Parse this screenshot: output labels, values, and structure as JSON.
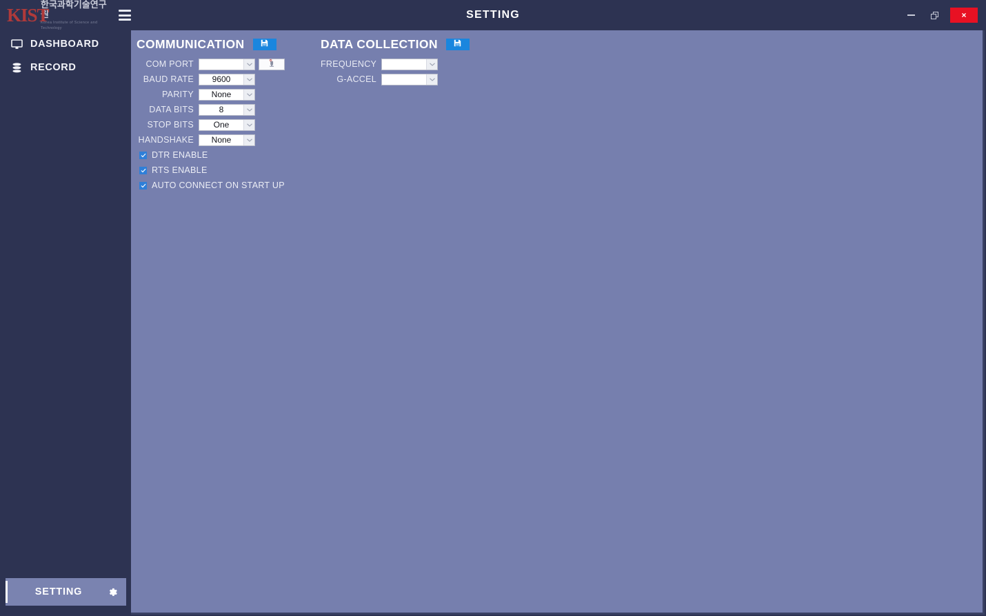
{
  "window": {
    "title": "SETTING",
    "minimize_label": "minimize",
    "restore_label": "restore",
    "close_label": "×"
  },
  "brand": {
    "logo_text": "KIST",
    "name_ko": "한국과학기술연구원",
    "name_en": "Korea Institute of Science and Technology",
    "menu_icon": "hamburger-icon"
  },
  "sidebar": {
    "items": [
      {
        "label": "DASHBOARD",
        "icon": "monitor-icon",
        "active": false
      },
      {
        "label": "RECORD",
        "icon": "database-icon",
        "active": false
      }
    ],
    "footer_item": {
      "label": "SETTING",
      "icon": "gear-icon",
      "active": true
    }
  },
  "panels": [
    {
      "title": "COMMUNICATION",
      "save_icon": "save-floppy-icon",
      "fields": [
        {
          "label": "COM PORT",
          "value": "",
          "placeholder": ""
        },
        {
          "label": "BAUD RATE",
          "value": "9600",
          "placeholder": ""
        },
        {
          "label": "PARITY",
          "value": "None",
          "placeholder": ""
        },
        {
          "label": "DATA BITS",
          "value": "8",
          "placeholder": ""
        },
        {
          "label": "STOP BITS",
          "value": "One",
          "placeholder": ""
        },
        {
          "label": "HANDSHAKE",
          "value": "None",
          "placeholder": ""
        }
      ],
      "refresh_button": {
        "icon": "refresh-ports-icon",
        "label": ""
      },
      "checkboxes": [
        {
          "label": "DTR ENABLE",
          "checked": true
        },
        {
          "label": "RTS ENABLE",
          "checked": true
        },
        {
          "label": "AUTO CONNECT ON START UP",
          "checked": true
        }
      ]
    },
    {
      "title": "DATA COLLECTION",
      "save_icon": "save-floppy-icon",
      "fields": [
        {
          "label": "FREQUENCY",
          "value": "",
          "placeholder": ""
        },
        {
          "label": "G-ACCEL",
          "value": "",
          "placeholder": ""
        }
      ]
    }
  ],
  "colors": {
    "sidebar_bg": "#2d3352",
    "content_bg": "#767fae",
    "accent_blue": "#1a86de",
    "active_item_bg": "#7a83b0",
    "close_red": "#e81123",
    "logo_red": "#b03a3a",
    "checkbox_blue": "#2f7fd8"
  }
}
